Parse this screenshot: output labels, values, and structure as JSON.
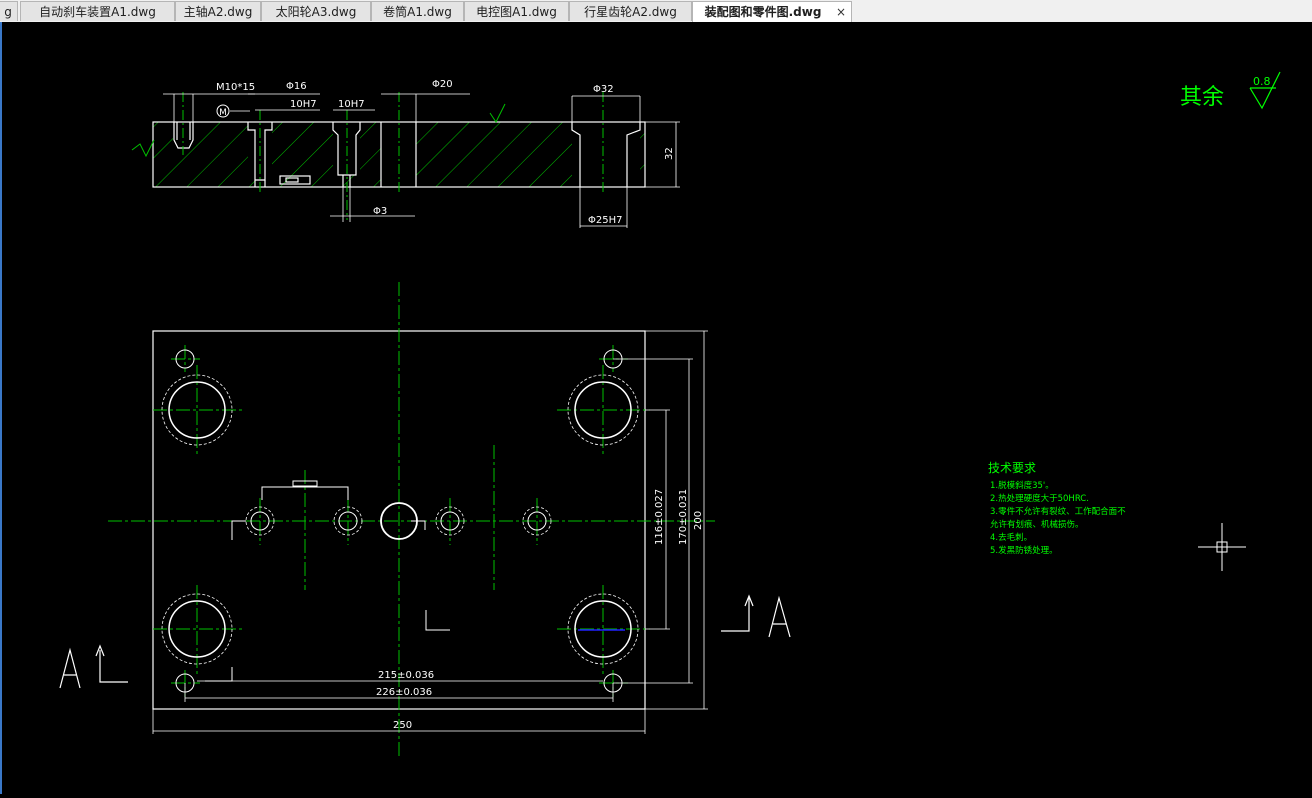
{
  "tabs": [
    {
      "label": "g"
    },
    {
      "label": "自动刹车装置A1.dwg"
    },
    {
      "label": "主轴A2.dwg"
    },
    {
      "label": "太阳轮A3.dwg"
    },
    {
      "label": "卷筒A1.dwg"
    },
    {
      "label": "电控图A1.dwg"
    },
    {
      "label": "行星齿轮A2.dwg"
    },
    {
      "label": "装配图和零件图.dwg",
      "close": "×"
    }
  ],
  "drawing": {
    "colors": {
      "background": "#000000",
      "outline": "#ffffff",
      "center": "#00c000",
      "hatch": "#00c000",
      "text_green": "#00ff00"
    },
    "section_view": {
      "dims": {
        "m10": "M10*15",
        "d16": "Φ16",
        "h7a": "10H7",
        "h7b": "10H7",
        "d20": "Φ20",
        "d32": "Φ32",
        "d25": "Φ25H7",
        "d3": "Φ3",
        "thick": "32",
        "m_mark": "M"
      }
    },
    "plan_view": {
      "dims": {
        "d215": "215±0.036",
        "d226": "226±0.036",
        "d250": "250",
        "v116": "116±0.027",
        "v170": "170±0.031",
        "v200": "200"
      },
      "section_mark_left": "A",
      "section_mark_right": "A"
    },
    "roughness": {
      "label": "其余",
      "value": "0.8"
    },
    "tech_req": {
      "title": "技术要求",
      "lines": [
        "1.脱模斜度35'。",
        "2.热处理硬度大于50HRC.",
        "3.零件不允许有裂纹、工作配合面不",
        "允许有划痕、机械损伤。",
        "4.去毛刺。",
        "5.发黑防锈处理。"
      ]
    }
  }
}
